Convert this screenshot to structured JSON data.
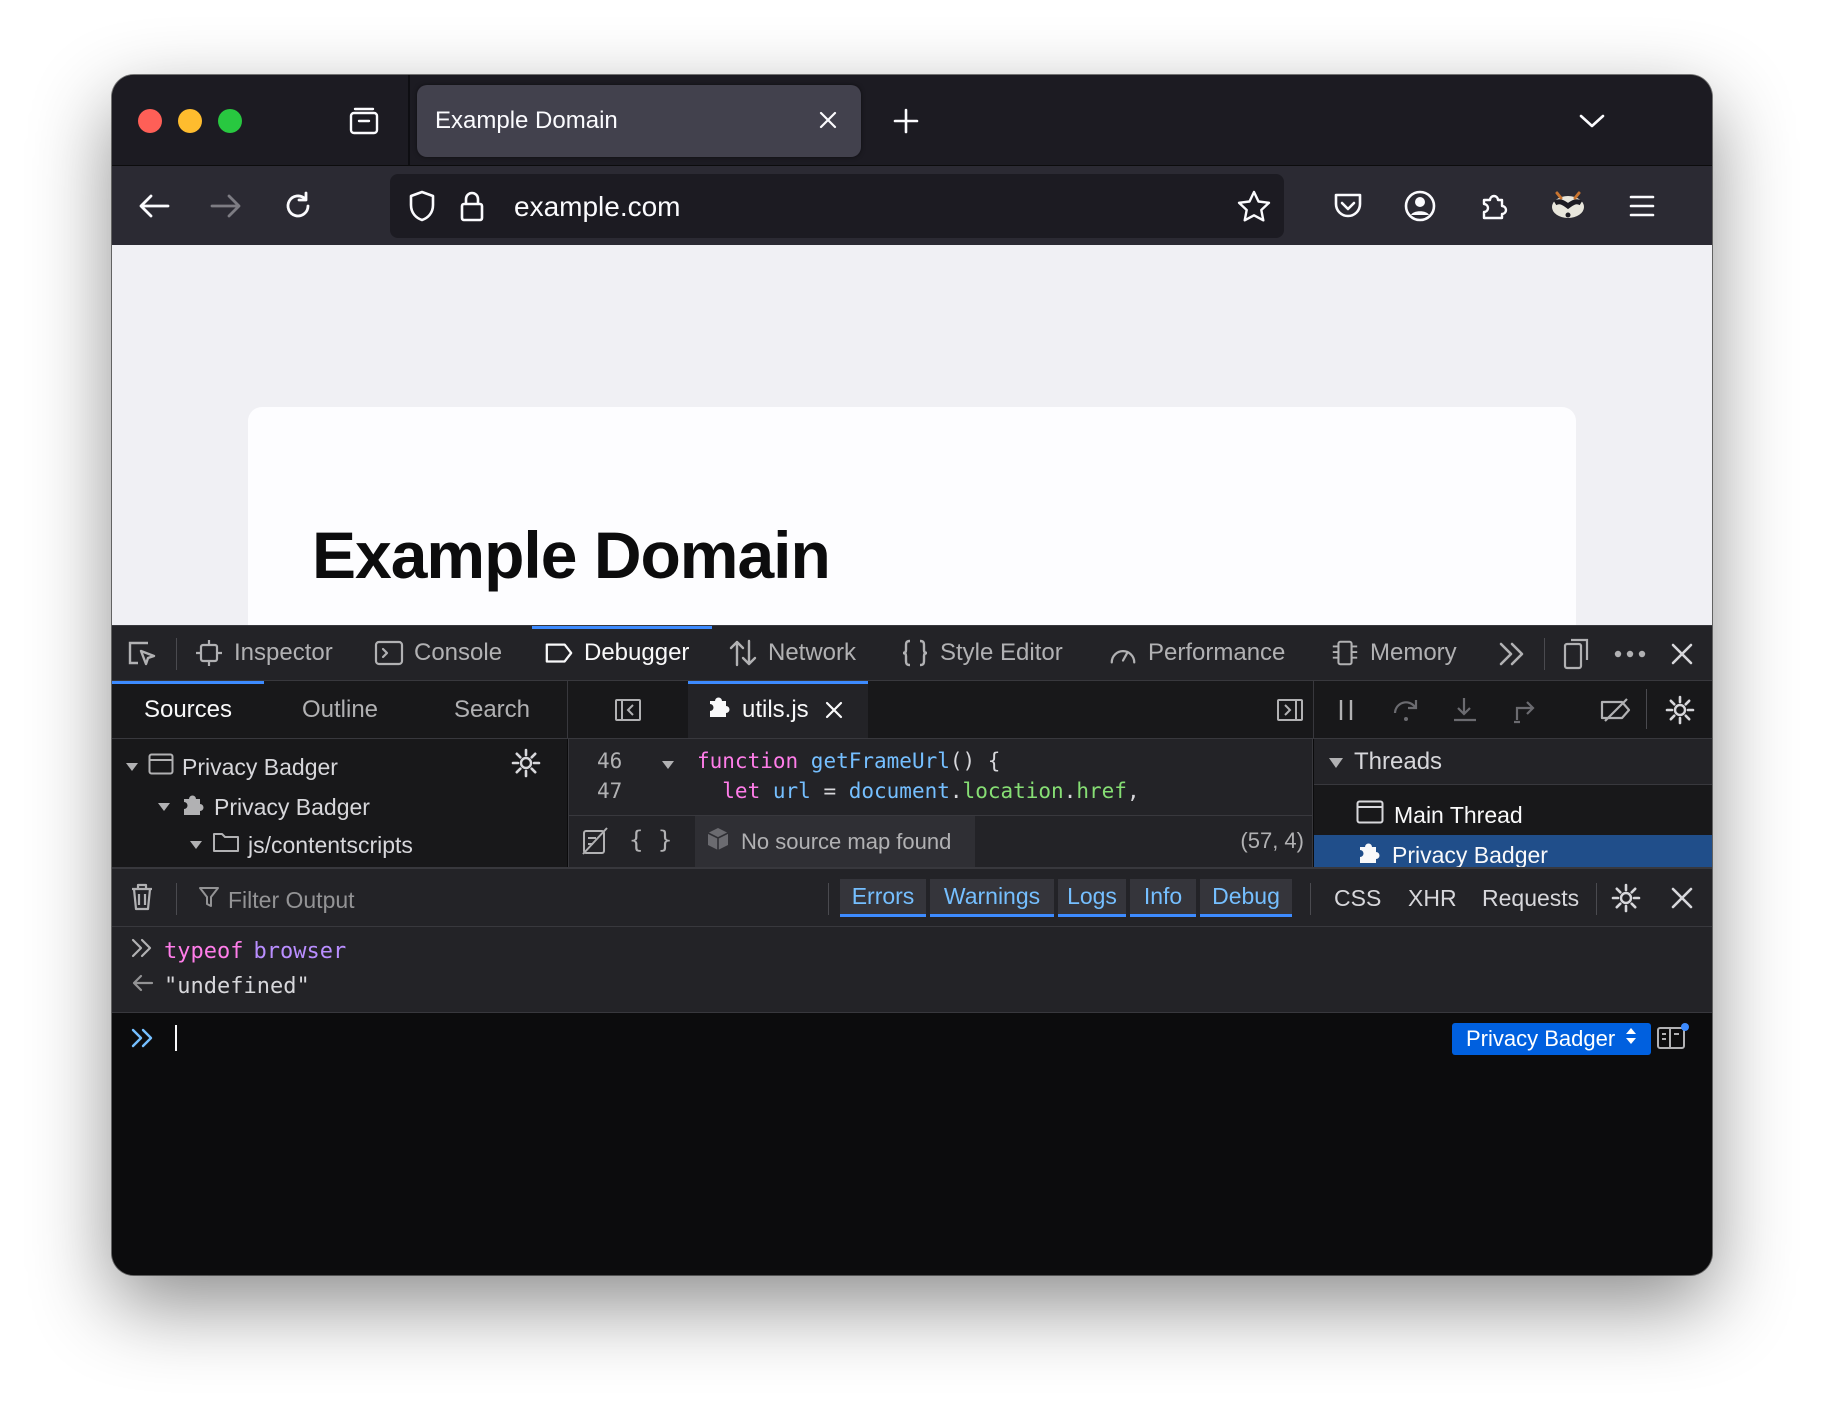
{
  "browser": {
    "tab_title": "Example Domain",
    "url": "example.com"
  },
  "page": {
    "heading": "Example Domain"
  },
  "devtools": {
    "tools": [
      "Inspector",
      "Console",
      "Debugger",
      "Network",
      "Style Editor",
      "Performance",
      "Memory"
    ],
    "active_tool": "Debugger",
    "source_tabs": [
      "Sources",
      "Outline",
      "Search"
    ],
    "active_source_tab": "Sources",
    "editor_file": "utils.js",
    "tree": [
      {
        "label": "Privacy Badger"
      },
      {
        "label": "Privacy Badger"
      },
      {
        "label": "js/contentscripts"
      }
    ],
    "code_lines": [
      {
        "num": "46",
        "kw": "function",
        "rest_fn": " getFrameUrl",
        "rest": "() {"
      },
      {
        "num": "47",
        "kw": "  let",
        "rest_fn": " url",
        "rest_eq": " = ",
        "obj": "document",
        "dot1": ".",
        "prop1": "location",
        "dot2": ".",
        "prop2": "href",
        "end": ","
      }
    ],
    "source_map_status": "No source map found",
    "cursor_position": "(57, 4)",
    "threads_header": "Threads",
    "threads": [
      "Main Thread",
      "Privacy Badger"
    ],
    "selected_thread": "Privacy Badger"
  },
  "console": {
    "filter_placeholder": "Filter Output",
    "levels": [
      "Errors",
      "Warnings",
      "Logs",
      "Info",
      "Debug"
    ],
    "extra_filters": [
      "CSS",
      "XHR",
      "Requests"
    ],
    "input_echo_kw": "typeof",
    "input_echo_rest": "browser",
    "result": "\"undefined\"",
    "context": "Privacy Badger"
  },
  "colors": {
    "accent": "#3d8bff",
    "selected_thread_bg": "#204e8a",
    "context_button": "#0060df",
    "keyword": "#ff7de9",
    "function_name": "#75bfff",
    "property": "#86de74"
  }
}
